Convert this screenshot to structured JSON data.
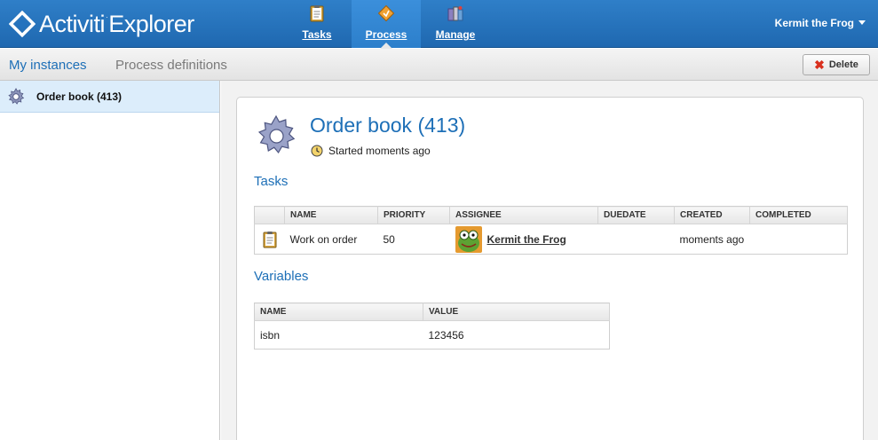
{
  "app": {
    "title_main": "Activiti",
    "title_sup": "·",
    "title_tail": "Explorer"
  },
  "nav": [
    {
      "label": "Tasks",
      "icon": "clipboard-icon"
    },
    {
      "label": "Process",
      "icon": "process-diamond-icon"
    },
    {
      "label": "Manage",
      "icon": "manage-icon"
    }
  ],
  "user": {
    "name": "Kermit the Frog"
  },
  "subtabs": {
    "active": "My instances",
    "inactive": "Process definitions"
  },
  "toolbar": {
    "delete_label": "Delete"
  },
  "list": [
    {
      "label": "Order book (413)"
    }
  ],
  "detail": {
    "title": "Order book (413)",
    "started": "Started moments ago",
    "tasks_title": "Tasks",
    "variables_title": "Variables"
  },
  "tasks_table": {
    "headers": [
      "NAME",
      "PRIORITY",
      "ASSIGNEE",
      "DUEDATE",
      "CREATED",
      "COMPLETED"
    ],
    "rows": [
      {
        "name": "Work on order",
        "priority": "50",
        "assignee": "Kermit the Frog",
        "duedate": "",
        "created": "moments ago",
        "completed": ""
      }
    ]
  },
  "vars_table": {
    "headers": [
      "NAME",
      "VALUE"
    ],
    "rows": [
      {
        "name": "isbn",
        "value": "123456"
      }
    ]
  },
  "colors": {
    "brand": "#2573be",
    "accent": "#1d6fb7",
    "selected": "#dcedfb"
  }
}
